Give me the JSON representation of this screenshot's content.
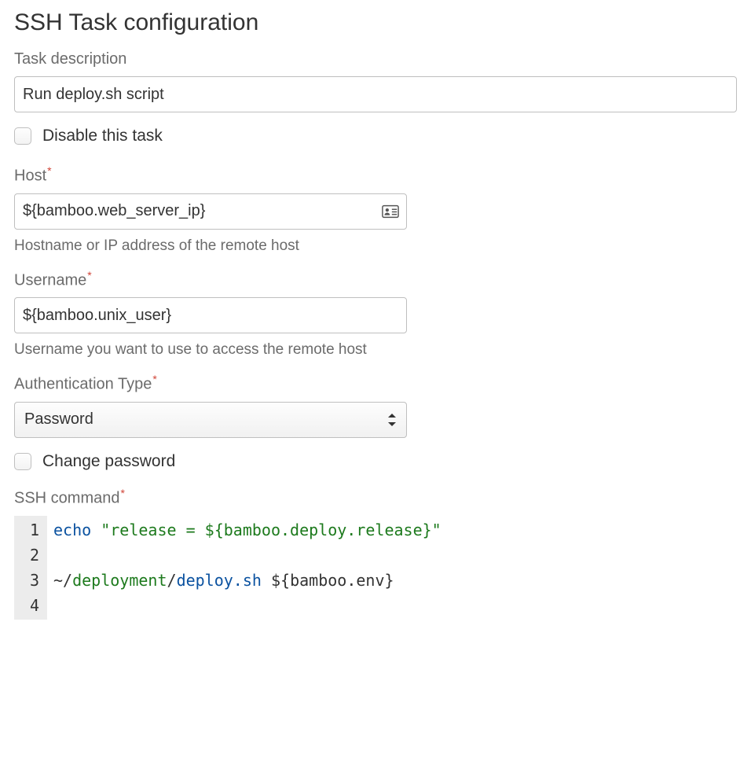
{
  "title": "SSH Task configuration",
  "fields": {
    "task_description": {
      "label": "Task description",
      "value": "Run deploy.sh script"
    },
    "disable_task": {
      "label": "Disable this task",
      "checked": false
    },
    "host": {
      "label": "Host",
      "required": true,
      "value": "${bamboo.web_server_ip}",
      "help": "Hostname or IP address of the remote host"
    },
    "username": {
      "label": "Username",
      "required": true,
      "value": "${bamboo.unix_user}",
      "help": "Username you want to use to access the remote host"
    },
    "auth_type": {
      "label": "Authentication Type",
      "required": true,
      "value": "Password"
    },
    "change_password": {
      "label": "Change password",
      "checked": false
    },
    "ssh_command": {
      "label": "SSH command",
      "required": true,
      "lines": [
        {
          "n": "1",
          "tokens": [
            {
              "t": "echo ",
              "cls": "tok-kw"
            },
            {
              "t": "\"release = ${bamboo.deploy.release}\"",
              "cls": "tok-str"
            }
          ]
        },
        {
          "n": "2",
          "tokens": []
        },
        {
          "n": "3",
          "tokens": [
            {
              "t": "~",
              "cls": "tok-punc"
            },
            {
              "t": "/",
              "cls": "tok-punc"
            },
            {
              "t": "deployment",
              "cls": "tok-path"
            },
            {
              "t": "/",
              "cls": "tok-punc"
            },
            {
              "t": "deploy.sh ",
              "cls": "tok-prog"
            },
            {
              "t": "$",
              "cls": "tok-var"
            },
            {
              "t": "{",
              "cls": "tok-punc"
            },
            {
              "t": "bamboo",
              "cls": "tok-plain"
            },
            {
              "t": ".",
              "cls": "tok-punc"
            },
            {
              "t": "env",
              "cls": "tok-plain"
            },
            {
              "t": "}",
              "cls": "tok-punc"
            }
          ]
        },
        {
          "n": "4",
          "tokens": []
        }
      ]
    }
  },
  "asterisk": "*"
}
